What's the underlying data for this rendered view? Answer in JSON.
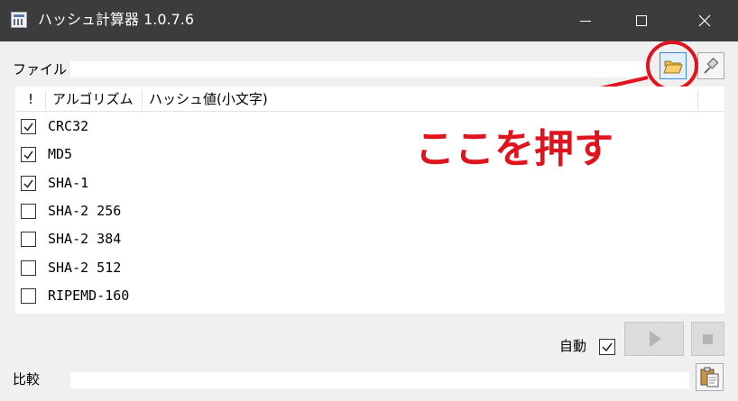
{
  "window": {
    "title": "ハッシュ計算器 1.0.7.6",
    "icons": {
      "app": "calculator-icon",
      "minimize": "minimize-icon",
      "maximize": "maximize-icon",
      "close": "close-icon"
    }
  },
  "file": {
    "label": "ファイル",
    "value": "",
    "open_icon": "folder-open-icon",
    "pin_icon": "pin-icon"
  },
  "list": {
    "columns": [
      "!",
      "アルゴリズム",
      "ハッシュ値(小文字)"
    ],
    "rows": [
      {
        "name": "CRC32",
        "checked": true
      },
      {
        "name": "MD5",
        "checked": true
      },
      {
        "name": "SHA-1",
        "checked": true
      },
      {
        "name": "SHA-2 256",
        "checked": false
      },
      {
        "name": "SHA-2 384",
        "checked": false
      },
      {
        "name": "SHA-2 512",
        "checked": false
      },
      {
        "name": "RIPEMD-160",
        "checked": false
      }
    ]
  },
  "annotation": {
    "text": "ここを押す",
    "color": "#e0141e"
  },
  "auto": {
    "label": "自動",
    "checked": true
  },
  "controls": {
    "play_icon": "play-icon",
    "stop_icon": "stop-icon",
    "paste_icon": "paste-icon"
  },
  "compare": {
    "label": "比較",
    "value": ""
  }
}
